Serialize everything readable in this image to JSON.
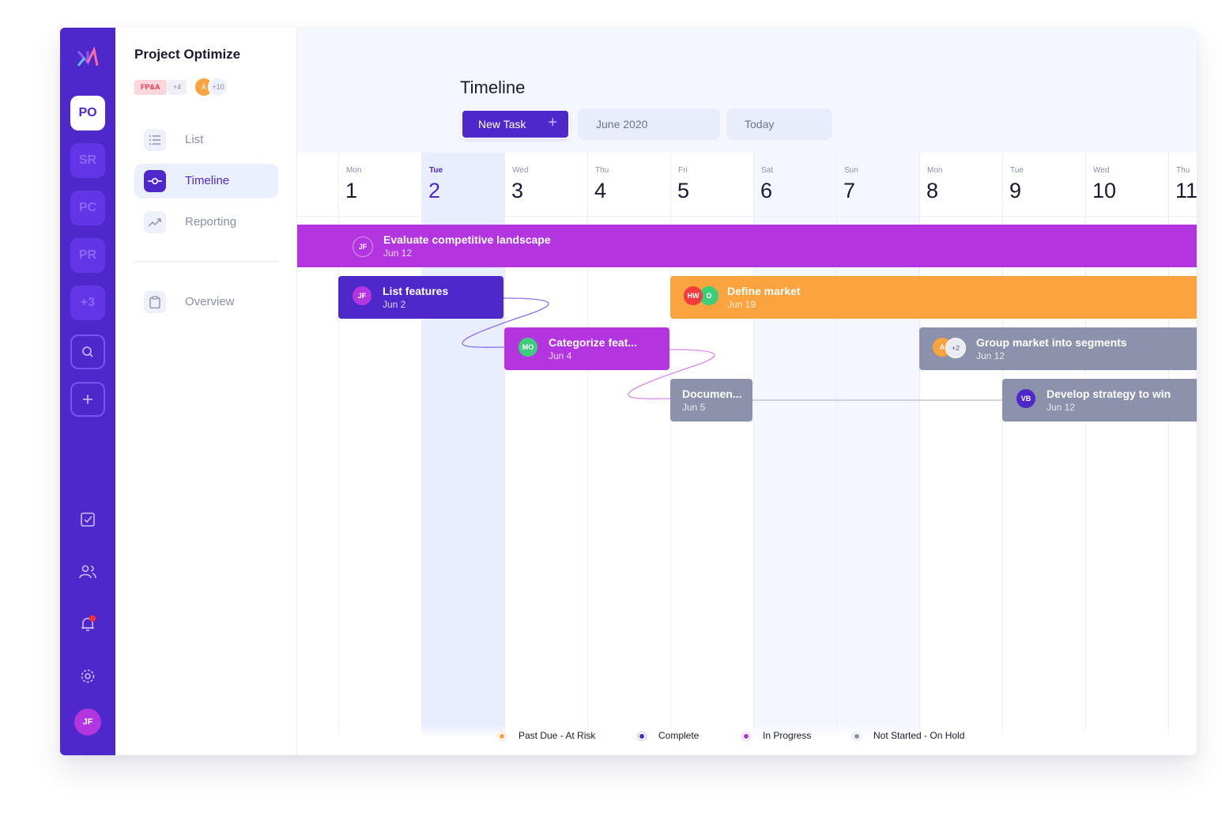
{
  "colors": {
    "brand": "#4e28cb",
    "in_progress": "#b235e0",
    "complete": "#4e28cb",
    "past_due": "#fba33e",
    "not_started": "#8c92ab"
  },
  "rail": {
    "projects": [
      "PO",
      "SR",
      "PC",
      "PR",
      "+3"
    ],
    "active_project": "PO",
    "icons": [
      "search-icon",
      "plus-icon",
      "tasks-icon",
      "people-icon",
      "bell-icon",
      "gear-icon"
    ],
    "user_initials": "JF"
  },
  "sidebar": {
    "title": "Project Optimize",
    "tag": "FP&A",
    "tag_more": "+4",
    "member_initial": "A",
    "member_more": "+10",
    "items": [
      {
        "label": "List",
        "icon": "list-icon"
      },
      {
        "label": "Timeline",
        "icon": "timeline-icon",
        "active": true
      },
      {
        "label": "Reporting",
        "icon": "trend-icon"
      },
      {
        "label": "Overview",
        "icon": "clipboard-icon"
      }
    ]
  },
  "header": {
    "title": "Timeline",
    "new_task": "New Task",
    "new_task_icon": "+",
    "month": "June 2020",
    "today": "Today"
  },
  "days": [
    {
      "name": "Mon",
      "num": "1"
    },
    {
      "name": "Tue",
      "num": "2",
      "today": true
    },
    {
      "name": "Wed",
      "num": "3"
    },
    {
      "name": "Thu",
      "num": "4"
    },
    {
      "name": "Fri",
      "num": "5"
    },
    {
      "name": "Sat",
      "num": "6",
      "weekend": true
    },
    {
      "name": "Sun",
      "num": "7",
      "weekend": true
    },
    {
      "name": "Mon",
      "num": "8"
    },
    {
      "name": "Tue",
      "num": "9"
    },
    {
      "name": "Wed",
      "num": "10"
    },
    {
      "name": "Thu",
      "num": "11"
    }
  ],
  "tasks": [
    {
      "name": "Evaluate competitive landscape",
      "date": "Jun 12",
      "status": "in_progress",
      "assignees": [
        "JF"
      ]
    },
    {
      "name": "List features",
      "date": "Jun 2",
      "status": "complete",
      "assignees": [
        "JF"
      ]
    },
    {
      "name": "Define market",
      "date": "Jun 19",
      "status": "past_due",
      "assignees": [
        "HW",
        "O"
      ]
    },
    {
      "name": "Categorize feat...",
      "date": "Jun 4",
      "status": "in_progress",
      "assignees": [
        "MO"
      ]
    },
    {
      "name": "Group market into segments",
      "date": "Jun 12",
      "status": "not_started",
      "assignees": [
        "A",
        "+2"
      ]
    },
    {
      "name": "Documen...",
      "date": "Jun 5",
      "status": "not_started",
      "assignees": []
    },
    {
      "name": "Develop strategy to win",
      "date": "Jun 12",
      "status": "not_started",
      "assignees": [
        "VB"
      ]
    }
  ],
  "legend": [
    {
      "label": "Past Due - At Risk",
      "color": "#fba33e"
    },
    {
      "label": "Complete",
      "color": "#4e28cb"
    },
    {
      "label": "In Progress",
      "color": "#b235e0"
    },
    {
      "label": "Not Started - On Hold",
      "color": "#8c92ab"
    }
  ]
}
